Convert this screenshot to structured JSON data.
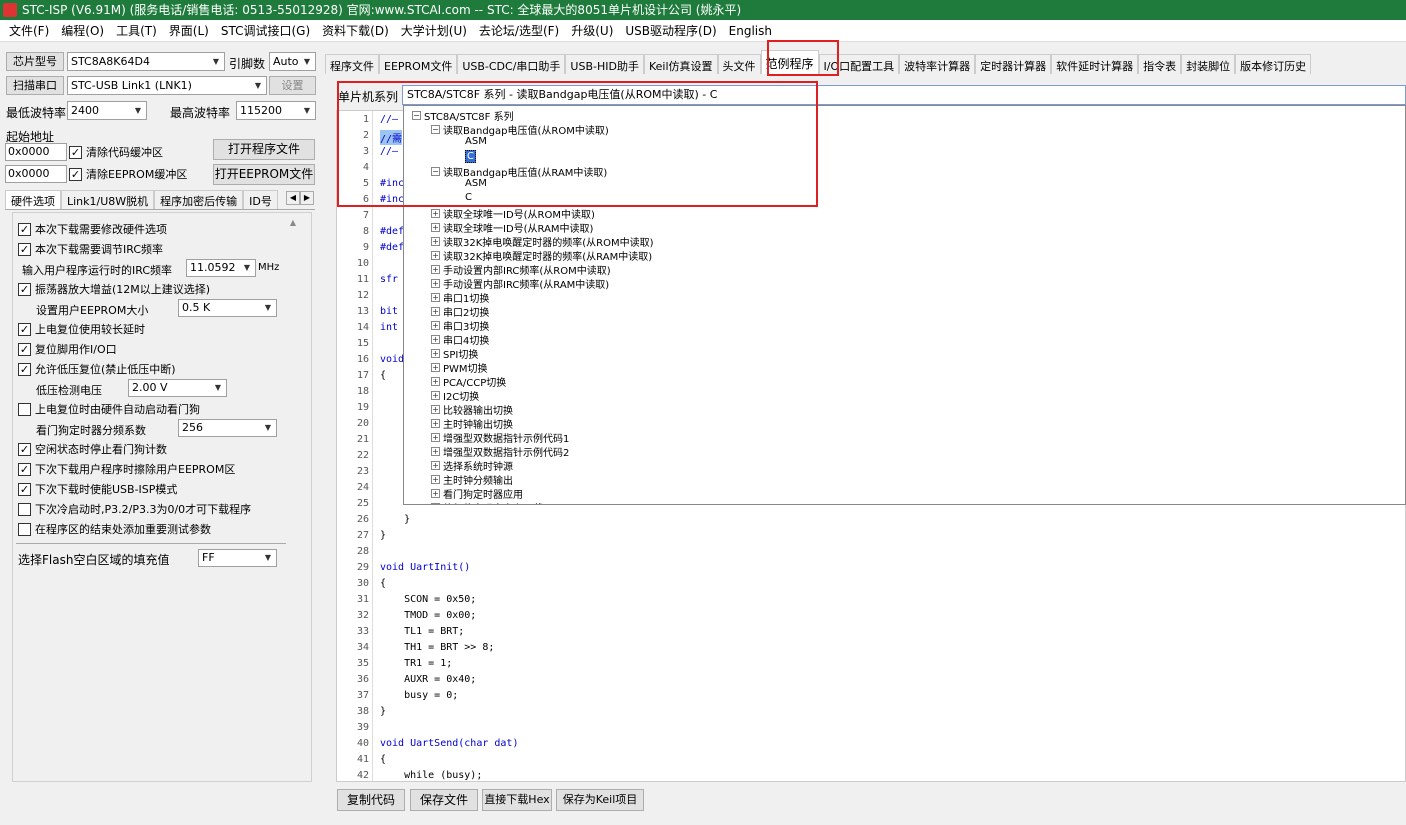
{
  "title": "STC-ISP (V6.91M) (服务电话/销售电话: 0513-55012928) 官网:www.STCAI.com  -- STC: 全球最大的8051单片机设计公司 (姚永平)",
  "menu": [
    "文件(F)",
    "编程(O)",
    "工具(T)",
    "界面(L)",
    "STC调试接口(G)",
    "资料下载(D)",
    "大学计划(U)",
    "去论坛/选型(F)",
    "升级(U)",
    "USB驱动程序(D)",
    "English"
  ],
  "left": {
    "chip_btn": "芯片型号",
    "chip_value": "STC8A8K64D4",
    "pin_label": "引脚数",
    "pin_value": "Auto",
    "scan_btn": "扫描串口",
    "port_value": "STC-USB Link1 (LNK1)",
    "settings_btn": "设置",
    "min_baud_label": "最低波特率",
    "min_baud": "2400",
    "max_baud_label": "最高波特率",
    "max_baud": "115200",
    "start_addr_label": "起始地址",
    "addr1": "0x0000",
    "clear_code": "清除代码缓冲区",
    "open_prog": "打开程序文件",
    "addr2": "0x0000",
    "clear_eeprom": "清除EEPROM缓冲区",
    "open_eeprom": "打开EEPROM文件",
    "tabs": [
      "硬件选项",
      "Link1/U8W脱机",
      "程序加密后传输",
      "ID号"
    ],
    "hw": {
      "opt1": "本次下载需要修改硬件选项",
      "opt2": "本次下载需要调节IRC频率",
      "irc_label": "输入用户程序运行时的IRC频率",
      "irc_value": "11.0592",
      "irc_unit": "MHz",
      "opt3": "振荡器放大增益(12M以上建议选择)",
      "eeprom_label": "设置用户EEPROM大小",
      "eeprom_value": "0.5 K",
      "opt4": "上电复位使用较长延时",
      "opt5": "复位脚用作I/O口",
      "opt6": "允许低压复位(禁止低压中断)",
      "lv_label": "低压检测电压",
      "lv_value": "2.00 V",
      "opt7": "上电复位时由硬件自动启动看门狗",
      "wdt_label": "看门狗定时器分频系数",
      "wdt_value": "256",
      "opt8": "空闲状态时停止看门狗计数",
      "opt9": "下次下载用户程序时擦除用户EEPROM区",
      "opt10": "下次下载时使能USB-ISP模式",
      "opt11": "下次冷启动时,P3.2/P3.3为0/0才可下载程序",
      "opt12": "在程序区的结束处添加重要测试参数",
      "fill_label": "选择Flash空白区域的填充值",
      "fill_value": "FF"
    }
  },
  "toptabs": [
    "程序文件",
    "EEPROM文件",
    "USB-CDC/串口助手",
    "USB-HID助手",
    "Keil仿真设置",
    "头文件",
    "范例程序",
    "I/O口配置工具",
    "波特率计算器",
    "定时器计算器",
    "软件延时计算器",
    "指令表",
    "封装脚位",
    "版本修订历史"
  ],
  "series_label": "单片机系列",
  "series_value": "STC8A/STC8F 系列 - 读取Bandgap电压值(从ROM中读取) - C",
  "code_lines": [
    {
      "n": "1",
      "t": "//—"
    },
    {
      "n": "2",
      "t": "//需"
    },
    {
      "n": "3",
      "t": "//—"
    },
    {
      "n": "4",
      "t": ""
    },
    {
      "n": "5",
      "t": "#inc"
    },
    {
      "n": "6",
      "t": "#inc"
    },
    {
      "n": "7",
      "t": ""
    },
    {
      "n": "8",
      "t": "#def"
    },
    {
      "n": "9",
      "t": "#def"
    },
    {
      "n": "10",
      "t": ""
    },
    {
      "n": "11",
      "t": "sfr"
    },
    {
      "n": "12",
      "t": ""
    },
    {
      "n": "13",
      "t": "bit"
    },
    {
      "n": "14",
      "t": "int"
    },
    {
      "n": "15",
      "t": ""
    },
    {
      "n": "16",
      "t": "void"
    },
    {
      "n": "17",
      "t": "{"
    },
    {
      "n": "18",
      "t": ""
    },
    {
      "n": "19",
      "t": ""
    },
    {
      "n": "20",
      "t": ""
    },
    {
      "n": "21",
      "t": ""
    },
    {
      "n": "22",
      "t": ""
    },
    {
      "n": "23",
      "t": ""
    },
    {
      "n": "24",
      "t": ""
    },
    {
      "n": "25",
      "t": ""
    },
    {
      "n": "26",
      "t": "    }"
    },
    {
      "n": "27",
      "t": "}"
    },
    {
      "n": "28",
      "t": ""
    },
    {
      "n": "29",
      "t": "void UartInit()"
    },
    {
      "n": "30",
      "t": "{"
    },
    {
      "n": "31",
      "t": "    SCON = 0x50;"
    },
    {
      "n": "32",
      "t": "    TMOD = 0x00;"
    },
    {
      "n": "33",
      "t": "    TL1 = BRT;"
    },
    {
      "n": "34",
      "t": "    TH1 = BRT >> 8;"
    },
    {
      "n": "35",
      "t": "    TR1 = 1;"
    },
    {
      "n": "36",
      "t": "    AUXR = 0x40;"
    },
    {
      "n": "37",
      "t": "    busy = 0;"
    },
    {
      "n": "38",
      "t": "}"
    },
    {
      "n": "39",
      "t": ""
    },
    {
      "n": "40",
      "t": "void UartSend(char dat)"
    },
    {
      "n": "41",
      "t": "{"
    },
    {
      "n": "42",
      "t": "    while (busy);"
    }
  ],
  "tree": {
    "root": "STC8A/STC8F 系列",
    "group1": "读取Bandgap电压值(从ROM中读取)",
    "asm1": "ASM",
    "c1": "C",
    "group2": "读取Bandgap电压值(从RAM中读取)",
    "asm2": "ASM",
    "c2": "C",
    "items": [
      "读取全球唯一ID号(从ROM中读取)",
      "读取全球唯一ID号(从RAM中读取)",
      "读取32K掉电唤醒定时器的频率(从ROM中读取)",
      "读取32K掉电唤醒定时器的频率(从RAM中读取)",
      "手动设置内部IRC频率(从ROM中读取)",
      "手动设置内部IRC频率(从RAM中读取)",
      "串口1切换",
      "串口2切换",
      "串口3切换",
      "串口4切换",
      "SPI切换",
      "PWM切换",
      "PCA/CCP切换",
      "I2C切换",
      "比较器输出切换",
      "主时钟输出切换",
      "增强型双数据指针示例代码1",
      "增强型双数据指针示例代码2",
      "选择系统时钟源",
      "主时钟分频输出",
      "看门狗定时器应用",
      "软复位实现自定义下载"
    ]
  },
  "bottom_buttons": [
    "复制代码",
    "保存文件",
    "直接下载Hex",
    "保存为Keil项目"
  ]
}
